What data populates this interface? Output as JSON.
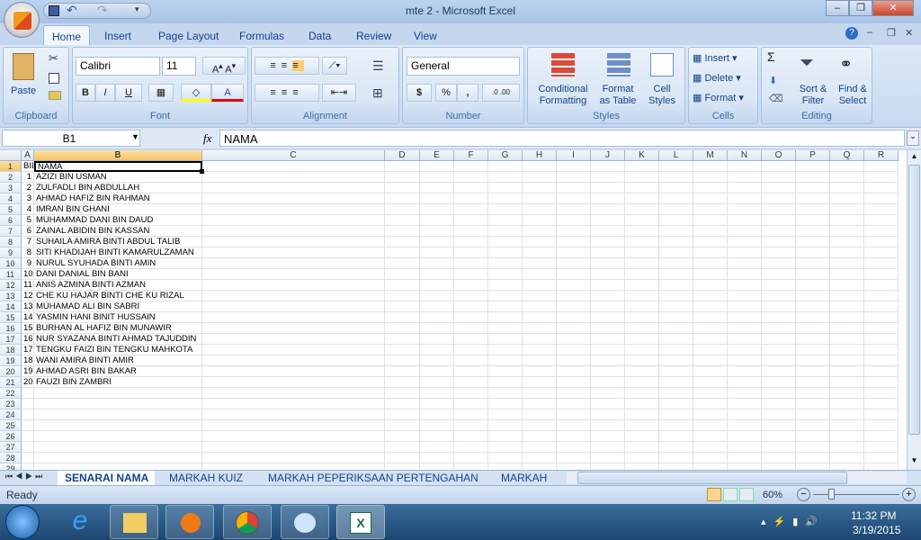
{
  "window": {
    "title": "mte 2 - Microsoft Excel"
  },
  "quick_access": {
    "save_icon": "save-icon",
    "undo_icon": "undo-icon",
    "redo_icon": "redo-icon"
  },
  "tabs": [
    "Home",
    "Insert",
    "Page Layout",
    "Formulas",
    "Data",
    "Review",
    "View"
  ],
  "active_tab": "Home",
  "ribbon": {
    "clipboard": {
      "label": "Clipboard",
      "paste": "Paste"
    },
    "font": {
      "label": "Font",
      "name": "Calibri",
      "size": "11",
      "bold": "B",
      "italic": "I",
      "underline": "U",
      "font_color": "A"
    },
    "alignment": {
      "label": "Alignment"
    },
    "number": {
      "label": "Number",
      "format": "General",
      "currency": "$",
      "percent": "%",
      "comma": ","
    },
    "styles": {
      "label": "Styles",
      "conditional": [
        "Conditional",
        "Formatting"
      ],
      "format_table": [
        "Format",
        "as Table"
      ],
      "cell_styles": [
        "Cell",
        "Styles"
      ]
    },
    "cells": {
      "label": "Cells",
      "insert": "Insert",
      "delete": "Delete",
      "format": "Format"
    },
    "editing": {
      "label": "Editing",
      "sort": [
        "Sort &",
        "Filter"
      ],
      "find": [
        "Find &",
        "Select"
      ],
      "sum": "Σ"
    }
  },
  "formula_bar": {
    "name_box": "B1",
    "fx": "fx",
    "value": "NAMA"
  },
  "columns": [
    "A",
    "B",
    "C",
    "D",
    "E",
    "F",
    "G",
    "H",
    "I",
    "J",
    "K",
    "L",
    "M",
    "N",
    "O",
    "P",
    "Q",
    "R"
  ],
  "selected_cell": "B1",
  "rows": [
    [
      "BIL",
      "NAMA"
    ],
    [
      "1",
      "AZIZI BIN USMAN"
    ],
    [
      "2",
      "ZULFADLI BIN ABDULLAH"
    ],
    [
      "3",
      "AHMAD HAFIZ BIN RAHMAN"
    ],
    [
      "4",
      "IMRAN BIN GHANI"
    ],
    [
      "5",
      "MUHAMMAD DANI BIN DAUD"
    ],
    [
      "6",
      "ZAINAL ABIDIN BIN KASSAN"
    ],
    [
      "7",
      "SUHAILA AMIRA BINTI ABDUL TALIB"
    ],
    [
      "8",
      "SITI KHADIJAH BINTI KAMARULZAMAN"
    ],
    [
      "9",
      "NURUL SYUHADA BINTI AMIN"
    ],
    [
      "10",
      "DANI DANIAL BIN BANI"
    ],
    [
      "11",
      "ANIS AZMINA BINTI AZMAN"
    ],
    [
      "12",
      "CHE KU HAJAR BINTI CHE KU RIZAL"
    ],
    [
      "13",
      "MUHAMAD ALI BIN SABRI"
    ],
    [
      "14",
      "YASMIN HANI BINIT HUSSAIN"
    ],
    [
      "15",
      "BURHAN AL HAFIZ BIN MUNAWIR"
    ],
    [
      "16",
      "NUR SYAZANA BINTI AHMAD TAJUDDIN"
    ],
    [
      "17",
      "TENGKU FAIZI BIN TENGKU MAHKOTA"
    ],
    [
      "18",
      "WANI AMIRA BINTI AMIR"
    ],
    [
      "19",
      "AHMAD ASRI BIN BAKAR"
    ],
    [
      "20",
      "FAUZI BIN ZAMBRI"
    ]
  ],
  "visible_row_count": 29,
  "sheets": [
    "SENARAI NAMA",
    "MARKAH KUIZ",
    "MARKAH PEPERIKSAAN PERTENGAHAN",
    "MARKAH"
  ],
  "active_sheet": "SENARAI NAMA",
  "status": {
    "text": "Ready",
    "zoom": "60%",
    "zoom_percent": 60
  },
  "taskbar": {
    "time": "11:32 PM",
    "date": "3/19/2015",
    "apps": [
      "internet-explorer",
      "file-explorer",
      "media-player",
      "chrome",
      "paint",
      "excel"
    ]
  }
}
